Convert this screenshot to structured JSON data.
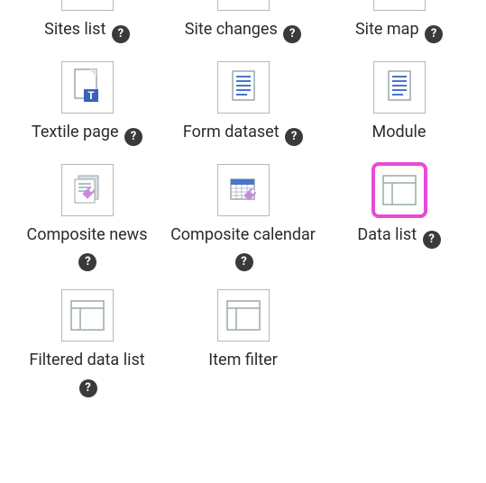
{
  "items": [
    {
      "label": "Sites list",
      "help": true,
      "icon": "sites-list",
      "row": 0,
      "highlight": false
    },
    {
      "label": "Site changes",
      "help": true,
      "icon": "site-changes",
      "row": 0,
      "highlight": false
    },
    {
      "label": "Site map",
      "help": true,
      "icon": "site-map",
      "row": 0,
      "highlight": false
    },
    {
      "label": "Textile page",
      "help": true,
      "icon": "textile-page",
      "row": 1,
      "highlight": false
    },
    {
      "label": "Form dataset",
      "help": true,
      "icon": "form-dataset",
      "row": 1,
      "highlight": false
    },
    {
      "label": "Module",
      "help": false,
      "icon": "module",
      "row": 1,
      "highlight": false
    },
    {
      "label": "Composite news",
      "help": true,
      "icon": "composite-news",
      "row": 2,
      "highlight": false
    },
    {
      "label": "Composite calendar",
      "help": true,
      "icon": "composite-calendar",
      "row": 2,
      "highlight": false
    },
    {
      "label": "Data list",
      "help": true,
      "icon": "data-list",
      "row": 2,
      "highlight": true
    },
    {
      "label": "Filtered data list",
      "help": true,
      "icon": "filtered-data-list",
      "row": 3,
      "highlight": false
    },
    {
      "label": "Item filter",
      "help": false,
      "icon": "item-filter",
      "row": 3,
      "highlight": false
    }
  ],
  "colors": {
    "highlight": "#e84bd6",
    "blue": "#4a76c9",
    "purple": "#a76cd1"
  }
}
